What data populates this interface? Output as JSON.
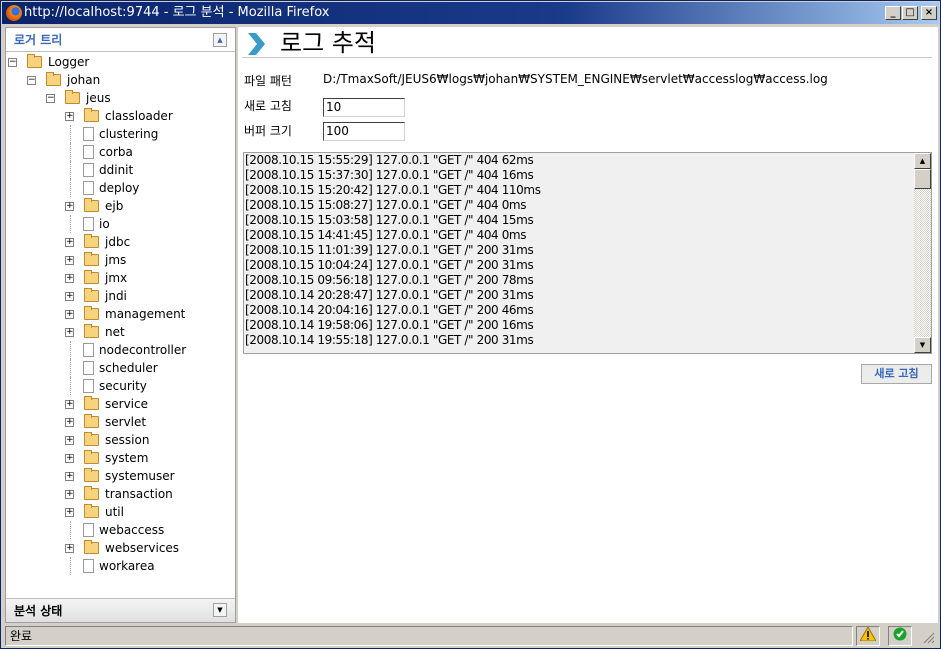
{
  "window": {
    "title": "http://localhost:9744 - 로그 분석 - Mozilla Firefox"
  },
  "left_panel": {
    "title": "로거 트리",
    "footer_title": "분석 상태"
  },
  "tree": [
    {
      "label": "Logger",
      "level": 0,
      "type": "folder-open",
      "toggle": "-"
    },
    {
      "label": "johan",
      "level": 1,
      "type": "folder-open",
      "toggle": "-"
    },
    {
      "label": "jeus",
      "level": 2,
      "type": "folder-open",
      "toggle": "-"
    },
    {
      "label": "classloader",
      "level": 3,
      "type": "folder",
      "toggle": "+"
    },
    {
      "label": "clustering",
      "level": 3,
      "type": "file"
    },
    {
      "label": "corba",
      "level": 3,
      "type": "file"
    },
    {
      "label": "ddinit",
      "level": 3,
      "type": "file"
    },
    {
      "label": "deploy",
      "level": 3,
      "type": "file"
    },
    {
      "label": "ejb",
      "level": 3,
      "type": "folder",
      "toggle": "+"
    },
    {
      "label": "io",
      "level": 3,
      "type": "file"
    },
    {
      "label": "jdbc",
      "level": 3,
      "type": "folder",
      "toggle": "+"
    },
    {
      "label": "jms",
      "level": 3,
      "type": "folder",
      "toggle": "+"
    },
    {
      "label": "jmx",
      "level": 3,
      "type": "folder",
      "toggle": "+"
    },
    {
      "label": "jndi",
      "level": 3,
      "type": "folder",
      "toggle": "+"
    },
    {
      "label": "management",
      "level": 3,
      "type": "folder",
      "toggle": "+"
    },
    {
      "label": "net",
      "level": 3,
      "type": "folder",
      "toggle": "+"
    },
    {
      "label": "nodecontroller",
      "level": 3,
      "type": "file"
    },
    {
      "label": "scheduler",
      "level": 3,
      "type": "file"
    },
    {
      "label": "security",
      "level": 3,
      "type": "file"
    },
    {
      "label": "service",
      "level": 3,
      "type": "folder",
      "toggle": "+"
    },
    {
      "label": "servlet",
      "level": 3,
      "type": "folder",
      "toggle": "+"
    },
    {
      "label": "session",
      "level": 3,
      "type": "folder",
      "toggle": "+"
    },
    {
      "label": "system",
      "level": 3,
      "type": "folder",
      "toggle": "+"
    },
    {
      "label": "systemuser",
      "level": 3,
      "type": "folder",
      "toggle": "+"
    },
    {
      "label": "transaction",
      "level": 3,
      "type": "folder",
      "toggle": "+"
    },
    {
      "label": "util",
      "level": 3,
      "type": "folder",
      "toggle": "+"
    },
    {
      "label": "webaccess",
      "level": 3,
      "type": "file"
    },
    {
      "label": "webservices",
      "level": 3,
      "type": "folder",
      "toggle": "+"
    },
    {
      "label": "workarea",
      "level": 3,
      "type": "file"
    }
  ],
  "main": {
    "title": "로그 추적",
    "file_pattern_label": "파일 패턴",
    "file_pattern": "D:/TmaxSoft/JEUS6₩logs₩johan₩SYSTEM_ENGINE₩servlet₩accesslog₩access.log",
    "refresh_label": "새로 고침",
    "refresh_value": "10",
    "buffer_label": "버퍼 크기",
    "buffer_value": "100",
    "refresh_button": "새로 고침",
    "log_lines": [
      "[2008.10.15 15:55:29] 127.0.0.1 \"GET /\" 404 62ms",
      "[2008.10.15 15:37:30] 127.0.0.1 \"GET /\" 404 16ms",
      "[2008.10.15 15:20:42] 127.0.0.1 \"GET /\" 404 110ms",
      "[2008.10.15 15:08:27] 127.0.0.1 \"GET /\" 404 0ms",
      "[2008.10.15 15:03:58] 127.0.0.1 \"GET /\" 404 15ms",
      "[2008.10.15 14:41:45] 127.0.0.1 \"GET /\" 404 0ms",
      "[2008.10.15 11:01:39] 127.0.0.1 \"GET /\" 200 31ms",
      "[2008.10.15 10:04:24] 127.0.0.1 \"GET /\" 200 31ms",
      "[2008.10.15 09:56:18] 127.0.0.1 \"GET /\" 200 78ms",
      "[2008.10.14 20:28:47] 127.0.0.1 \"GET /\" 200 31ms",
      "[2008.10.14 20:04:16] 127.0.0.1 \"GET /\" 200 46ms",
      "[2008.10.14 19:58:06] 127.0.0.1 \"GET /\" 200 16ms",
      "[2008.10.14 19:55:18] 127.0.0.1 \"GET /\" 200 31ms"
    ]
  },
  "status": {
    "text": "완료",
    "icons": [
      "warning-icon",
      "check-icon"
    ]
  },
  "colors": {
    "accent": "#3a68b8",
    "titlebar": "#0a246a",
    "chevron": "#3a9ac8"
  }
}
